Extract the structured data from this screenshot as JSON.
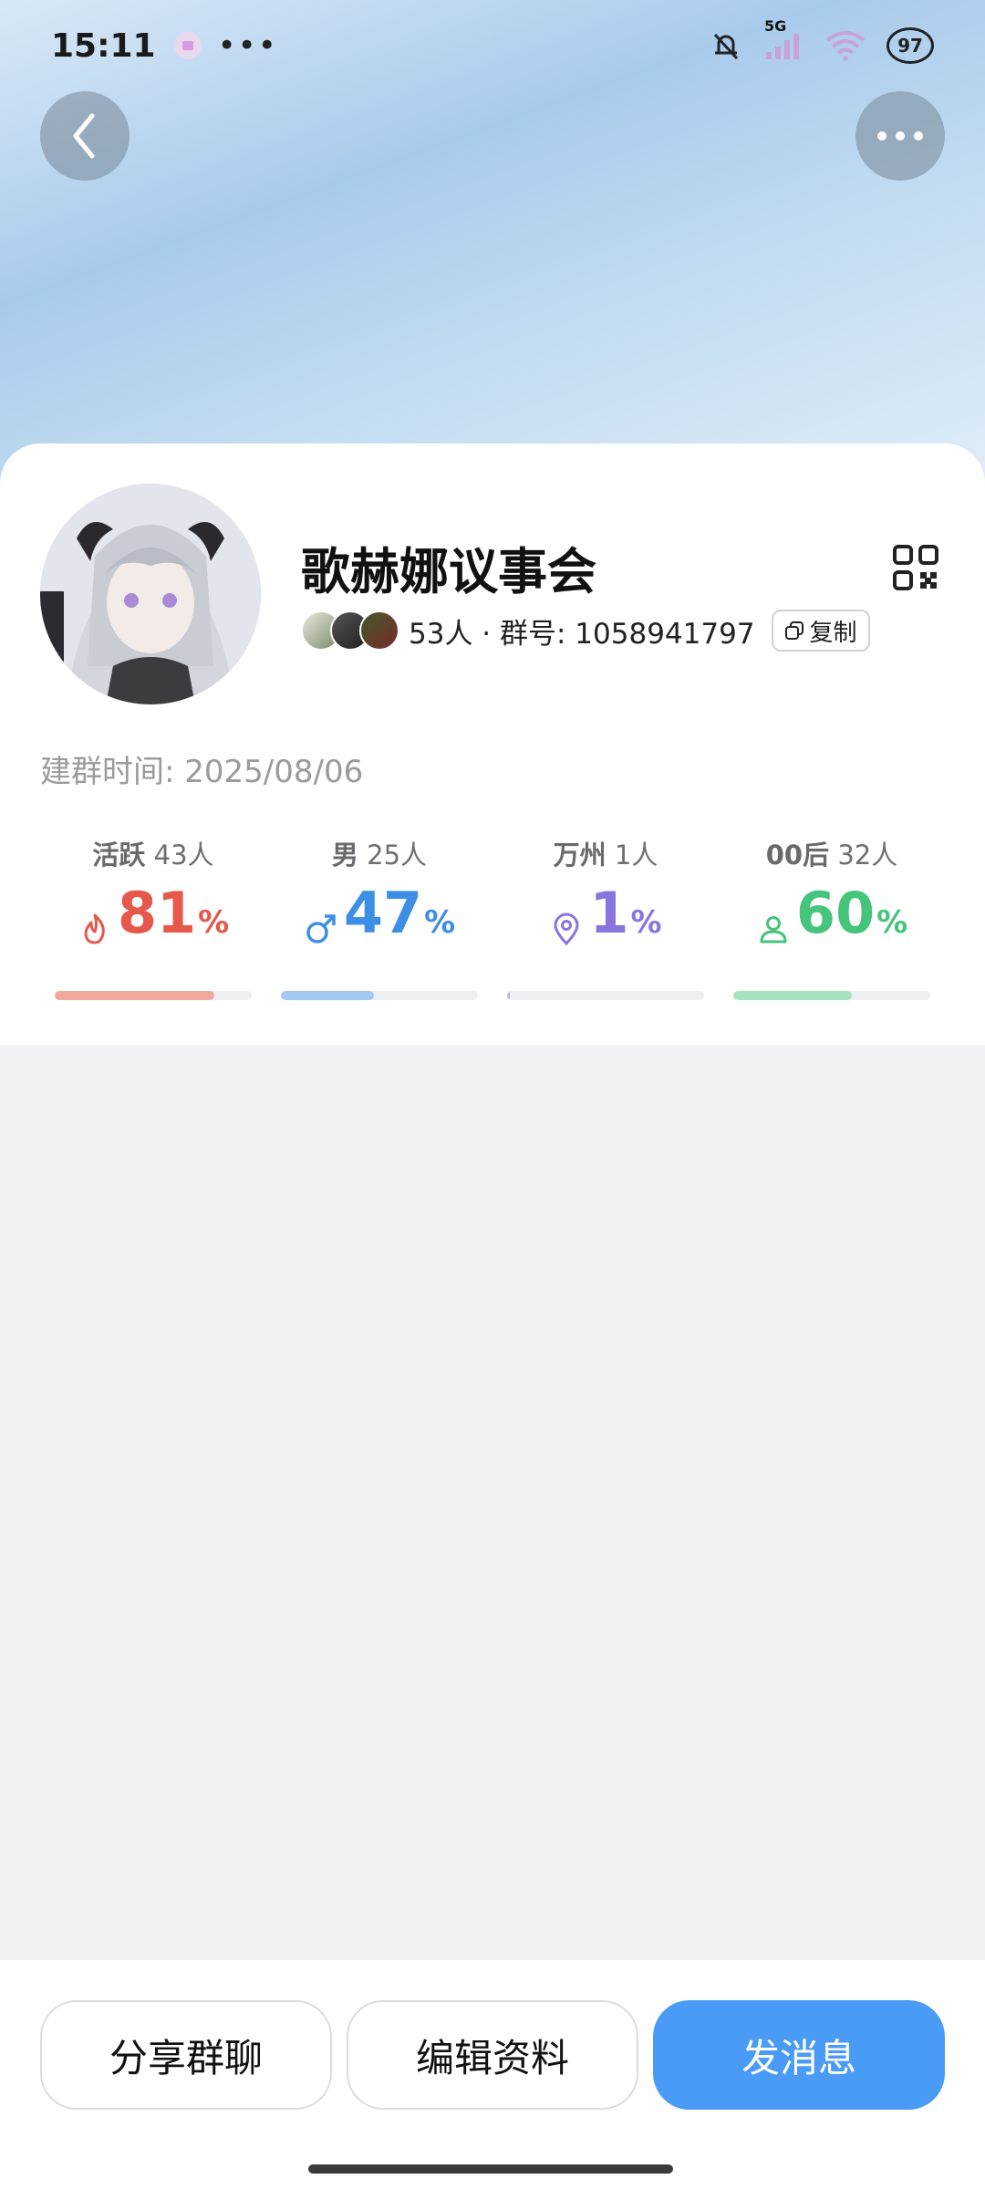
{
  "status_bar": {
    "time": "15:11",
    "more": "•••",
    "network": "5G",
    "battery": "97"
  },
  "group": {
    "name": "歌赫娜议事会",
    "members_text": "53人 · 群号: 1058941797",
    "copy_label": "复制",
    "created_label": "建群时间: 2025/08/06"
  },
  "stats": [
    {
      "label_main": "活跃",
      "label_count": "43人",
      "value": "81",
      "unit": "%",
      "fraction": 0.81,
      "color": "#e5584a",
      "bar_color": "#f0a89b",
      "icon": "fire-icon"
    },
    {
      "label_main": "男",
      "label_count": "25人",
      "value": "47",
      "unit": "%",
      "fraction": 0.47,
      "color": "#3d8fe6",
      "bar_color": "#a3c8f3",
      "icon": "male-icon"
    },
    {
      "label_main": "万州",
      "label_count": "1人",
      "value": "1",
      "unit": "%",
      "fraction": 0.01,
      "color": "#8a74df",
      "bar_color": "#c2b5ef",
      "icon": "location-icon"
    },
    {
      "label_main": "00后",
      "label_count": "32人",
      "value": "60",
      "unit": "%",
      "fraction": 0.6,
      "color": "#45c47c",
      "bar_color": "#a5e2be",
      "icon": "person-icon"
    }
  ],
  "actions": {
    "share": "分享群聊",
    "edit": "编辑资料",
    "send": "发消息"
  },
  "colors": {
    "primary": "#4a9bf5",
    "card": "#ffffff",
    "background": "#f1f1f6"
  }
}
